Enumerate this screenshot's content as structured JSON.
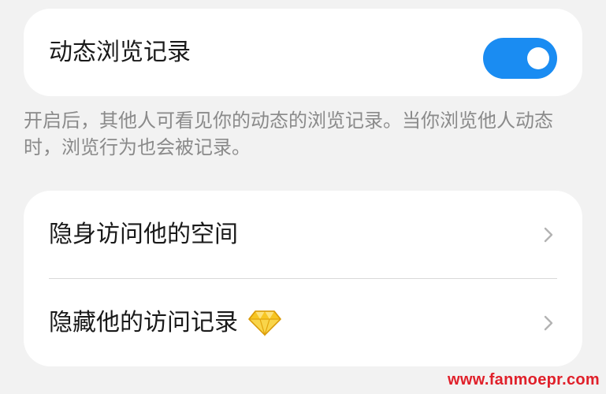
{
  "privacy": {
    "feed_history": {
      "label": "动态浏览记录",
      "enabled": true,
      "accent": "#1a8cf2"
    },
    "description": "开启后，其他人可看见你的动态的浏览记录。当你浏览他人动态时，浏览行为也会被记录。",
    "list": [
      {
        "label": "隐身访问他的空间",
        "icon": "chevron-right-icon"
      },
      {
        "label": "隐藏他的访问记录",
        "badge_icon": "diamond-icon",
        "icon": "chevron-right-icon"
      }
    ]
  },
  "watermark": "www.fanmoepr.com"
}
